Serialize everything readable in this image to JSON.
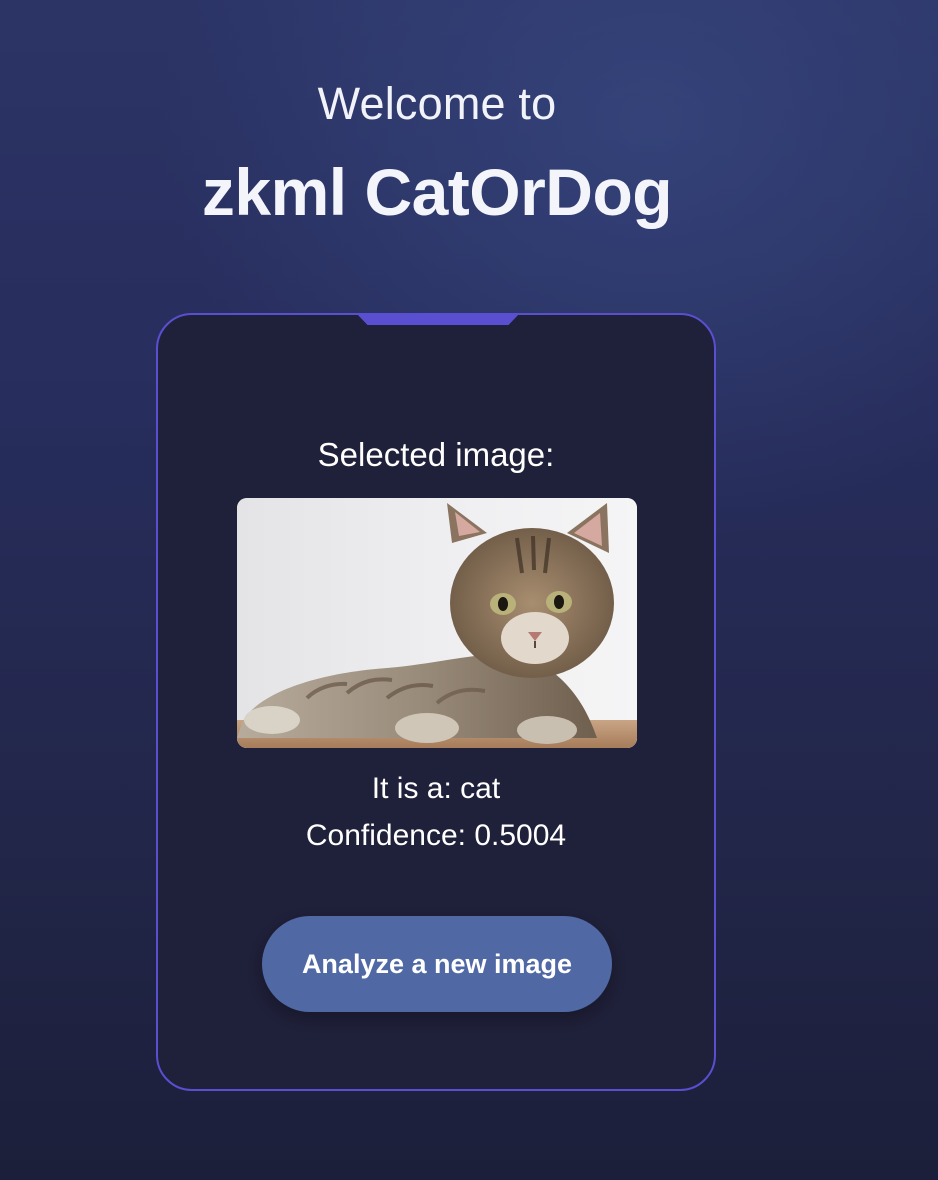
{
  "header": {
    "welcome": "Welcome to",
    "title": "zkml CatOrDog"
  },
  "card": {
    "selected_label": "Selected image:",
    "image_subject": "cat-photo",
    "result_label": "It is a: cat",
    "confidence_label": "Confidence: 0.5004",
    "button_label": "Analyze a new image"
  },
  "colors": {
    "accent": "#5a4fd1",
    "card_bg": "#1f2039",
    "button_bg": "#5069a4"
  }
}
